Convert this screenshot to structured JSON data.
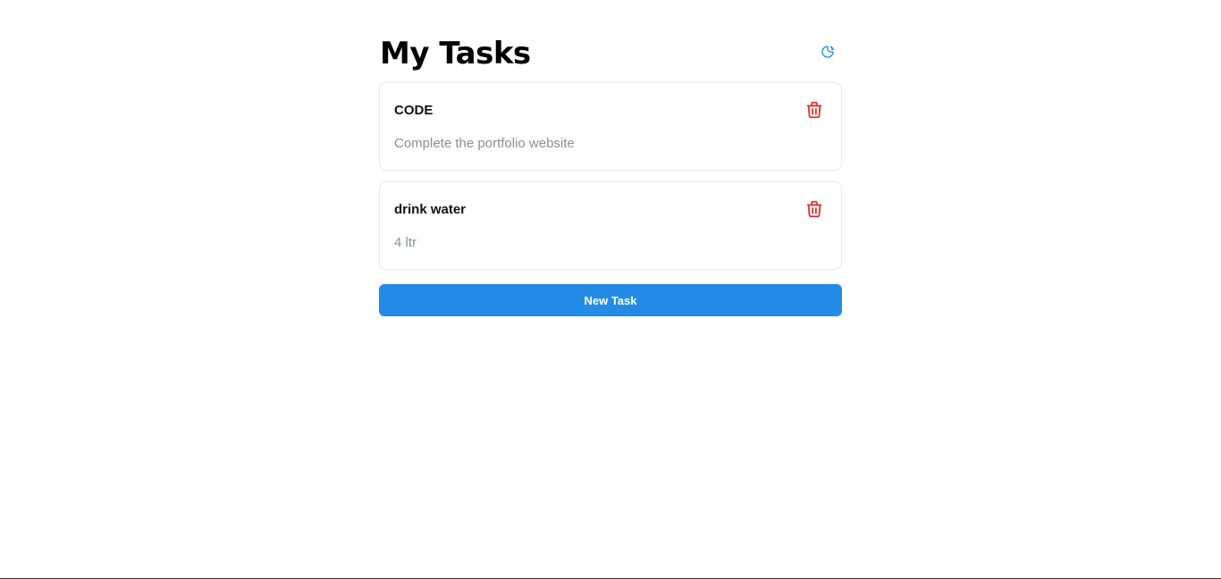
{
  "header": {
    "title": "My Tasks",
    "theme_toggle_icon": "moon-icon"
  },
  "tasks": [
    {
      "title": "CODE",
      "description": "Complete the portfolio website",
      "delete_icon": "trash-icon"
    },
    {
      "title": "drink water",
      "description": "4 ltr",
      "delete_icon": "trash-icon"
    }
  ],
  "actions": {
    "new_task_label": "New Task"
  },
  "colors": {
    "accent": "#228be6",
    "danger": "#e03131",
    "muted_text": "#8a8f98",
    "card_border": "#e5e7eb"
  }
}
